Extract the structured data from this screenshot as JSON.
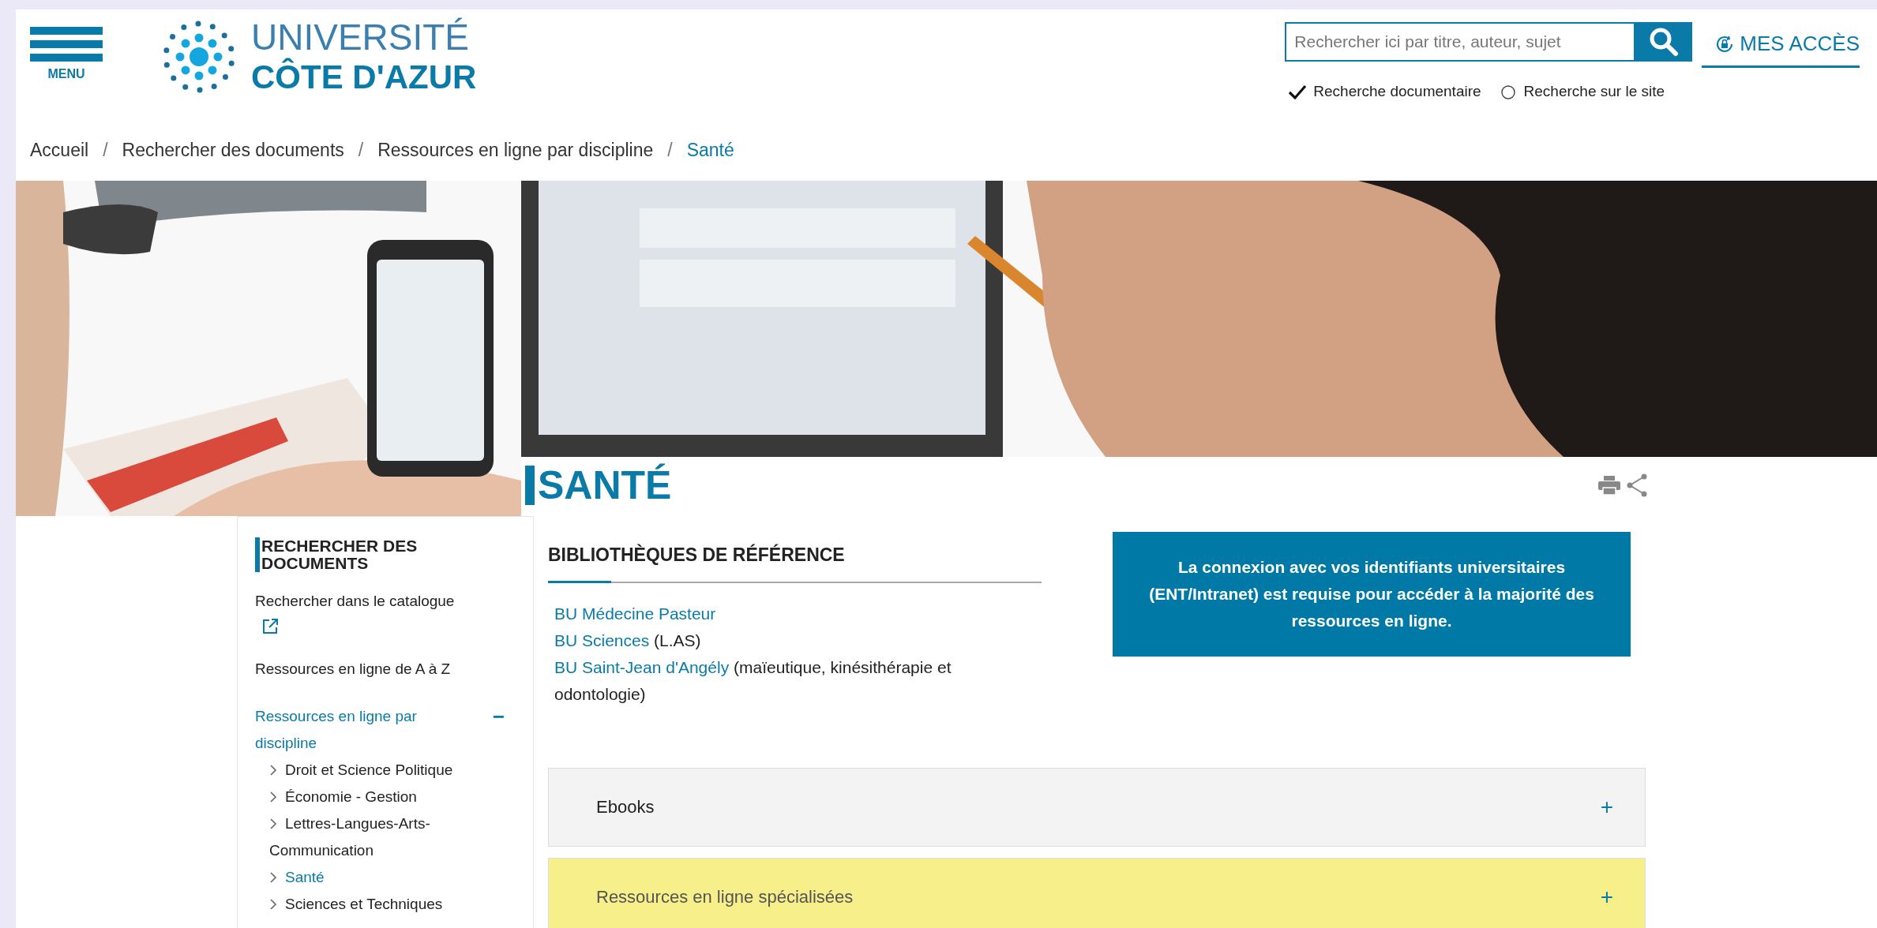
{
  "header": {
    "menu_label": "MENU",
    "logo": {
      "line_1": "UNIVERSITÉ",
      "line_2": "CÔTE D'AZUR"
    },
    "search": {
      "placeholder": "Rechercher ici par titre, auteur, sujet"
    },
    "access_link": "MES ACCÈS",
    "search_scopes": [
      {
        "label": "Recherche documentaire",
        "selected": true
      },
      {
        "label": "Recherche sur le site",
        "selected": false
      }
    ]
  },
  "breadcrumb": {
    "separator": "/",
    "items": [
      {
        "label": "Accueil",
        "current": false
      },
      {
        "label": "Rechercher des documents",
        "current": false
      },
      {
        "label": "Ressources en ligne par discipline",
        "current": false
      },
      {
        "label": "Santé",
        "current": true
      }
    ]
  },
  "page_title": "SANTÉ",
  "sidebar": {
    "title": "RECHERCHER DES DOCUMENTS",
    "items": [
      {
        "label": "Rechercher dans le catalogue",
        "external": true,
        "selected": false
      },
      {
        "label": "Ressources en ligne de A à Z",
        "selected": false
      },
      {
        "label": "Ressources en ligne par discipline",
        "selected": true,
        "expanded": true,
        "toggle": "−",
        "children": [
          {
            "label": "Droit et Science Politique",
            "selected": false
          },
          {
            "label": "Économie - Gestion",
            "selected": false
          },
          {
            "label": "Lettres-Langues-Arts-Communication",
            "selected": false
          },
          {
            "label": "Santé",
            "selected": true
          },
          {
            "label": "Sciences et Techniques",
            "selected": false
          }
        ]
      }
    ]
  },
  "content": {
    "section_title": "BIBLIOTHÈQUES DE RÉFÉRENCE",
    "libraries": [
      {
        "name": "BU Médecine Pasteur"
      },
      {
        "name": "BU Sciences",
        "note": "(L.AS)"
      },
      {
        "name": "BU Saint-Jean d'Angély",
        "note": "(maïeutique, kinésithérapie et odontologie)"
      }
    ],
    "notice": "La connexion avec vos identifiants universitaires (ENT/Intranet) est requise pour accéder à la majorité des ressources en ligne.",
    "accordions": [
      {
        "label": "Ebooks",
        "toggle": "+",
        "highlighted": false
      },
      {
        "label": "Ressources en ligne spécialisées",
        "toggle": "+",
        "highlighted": true
      }
    ]
  }
}
